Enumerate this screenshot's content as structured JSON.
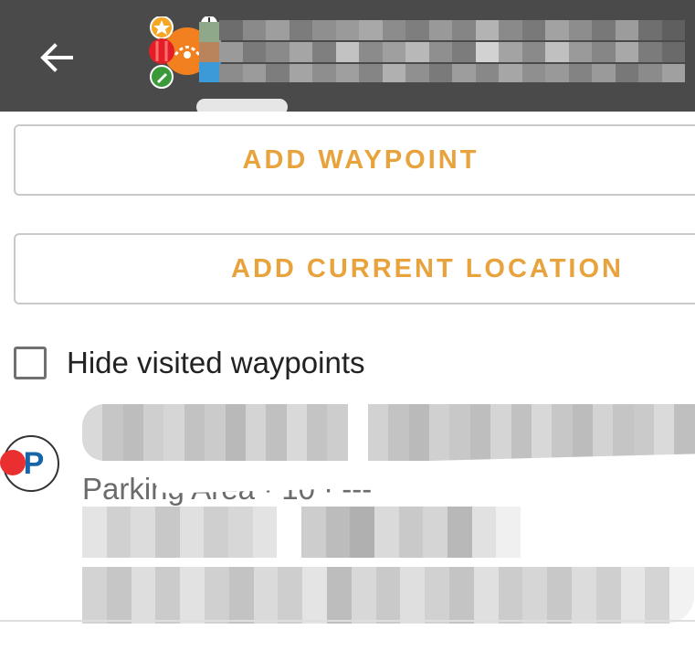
{
  "appbar": {
    "background": "#4a4a4a",
    "back_icon": "arrow-left-icon",
    "cache_icon": "cache-type-icon"
  },
  "buttons": {
    "add_waypoint": "ADD WAYPOINT",
    "add_current_location": "ADD CURRENT LOCATION",
    "accent": "#e8a33d"
  },
  "filter": {
    "hide_visited_label": "Hide visited waypoints",
    "checked": false
  },
  "waypoints": [
    {
      "type_icon": "parking-icon",
      "icon_glyph": "P",
      "subtitle": "Parking Area · 10 · ---"
    }
  ]
}
